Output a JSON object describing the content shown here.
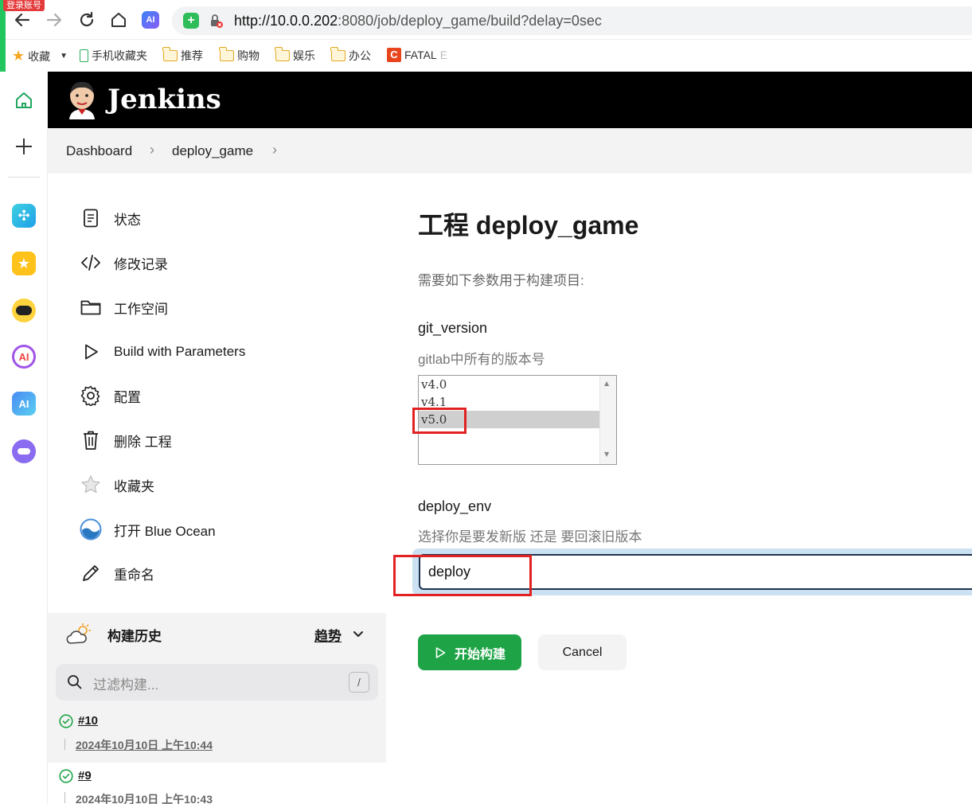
{
  "browser": {
    "login_tag": "登录账号",
    "url_host": "http://10.0.0.202",
    "url_rest": ":8080/job/deploy_game/build?delay=0sec",
    "ai_badge": "AI",
    "bookmarks": [
      {
        "label": "收藏",
        "icon": "star-icon"
      },
      {
        "label": "手机收藏夹",
        "icon": "phone-icon"
      },
      {
        "label": "推荐",
        "icon": "folder-icon"
      },
      {
        "label": "购物",
        "icon": "folder-icon"
      },
      {
        "label": "娱乐",
        "icon": "folder-icon"
      },
      {
        "label": "办公",
        "icon": "folder-icon"
      },
      {
        "label": "FATAL",
        "icon": "c-logo-icon"
      }
    ],
    "bookmark_trailing": "E",
    "sidebar_ai_label": "AI"
  },
  "jenkins": {
    "logo_text": "Jenkins",
    "breadcrumb": [
      "Dashboard",
      "deploy_game"
    ],
    "side_menu": [
      {
        "label": "状态",
        "icon": "notepad-icon"
      },
      {
        "label": "修改记录",
        "icon": "code-icon"
      },
      {
        "label": "工作空间",
        "icon": "folder-icon"
      },
      {
        "label": "Build with Parameters",
        "icon": "play-icon"
      },
      {
        "label": "配置",
        "icon": "gear-icon"
      },
      {
        "label": "删除 工程",
        "icon": "trash-icon"
      },
      {
        "label": "收藏夹",
        "icon": "star-icon"
      },
      {
        "label": "打开 Blue Ocean",
        "icon": "blue-ocean-icon"
      },
      {
        "label": "重命名",
        "icon": "pencil-icon"
      }
    ],
    "history": {
      "title": "构建历史",
      "trend": "趋势",
      "filter_placeholder": "过滤构建...",
      "shortcut": "/",
      "runs": [
        {
          "number": "#10",
          "time": "2024年10月10日 上午10:44",
          "status": "success"
        },
        {
          "number": "#9",
          "time": "2024年10月10日 上午10:43",
          "status": "success"
        }
      ]
    }
  },
  "main": {
    "title": "工程 deploy_game",
    "description": "需要如下参数用于构建项目:",
    "params": [
      {
        "name": "git_version",
        "description": "gitlab中所有的版本号",
        "options": [
          "v4.0",
          "v4.1",
          "v5.0"
        ],
        "selected": "v5.0"
      },
      {
        "name": "deploy_env",
        "description": "选择你是要发新版 还是 要回滚旧版本",
        "value": "deploy"
      }
    ],
    "build_button": "开始构建",
    "cancel_button": "Cancel"
  },
  "colors": {
    "header_bg": "#000000",
    "build_button": "#1ea446",
    "annotation_red": "#e22222",
    "focus_ring": "#cbe1f2"
  }
}
